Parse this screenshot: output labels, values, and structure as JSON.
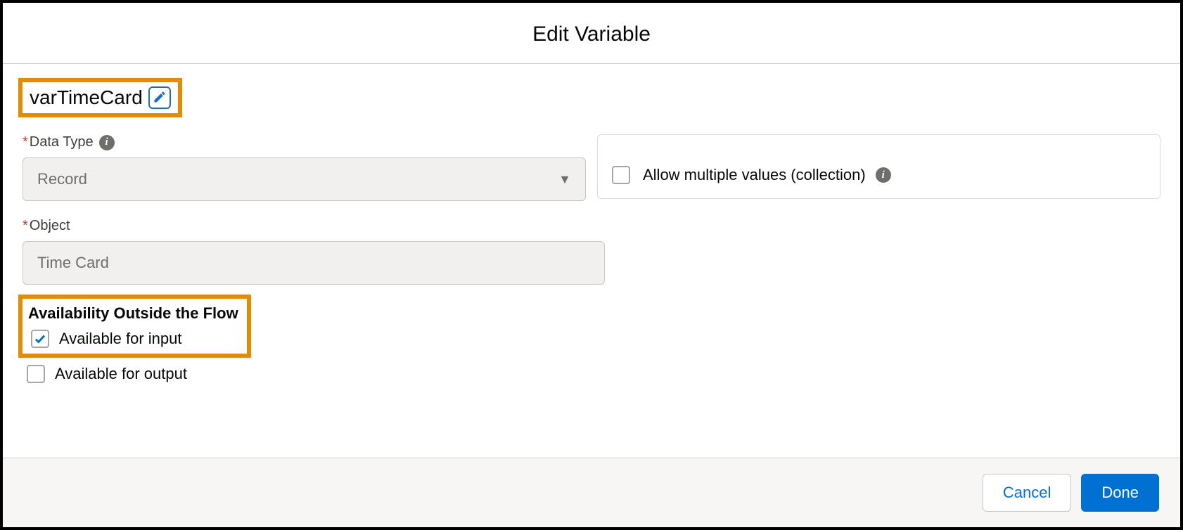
{
  "header": {
    "title": "Edit Variable"
  },
  "variable": {
    "name": "varTimeCard"
  },
  "fields": {
    "dataType": {
      "label": "Data Type",
      "value": "Record"
    },
    "allowMultiple": {
      "label": "Allow multiple values (collection)",
      "checked": false
    },
    "object": {
      "label": "Object",
      "value": "Time Card"
    }
  },
  "availability": {
    "sectionTitle": "Availability Outside the Flow",
    "inputLabel": "Available for input",
    "inputChecked": true,
    "outputLabel": "Available for output",
    "outputChecked": false
  },
  "footer": {
    "cancel": "Cancel",
    "done": "Done"
  }
}
